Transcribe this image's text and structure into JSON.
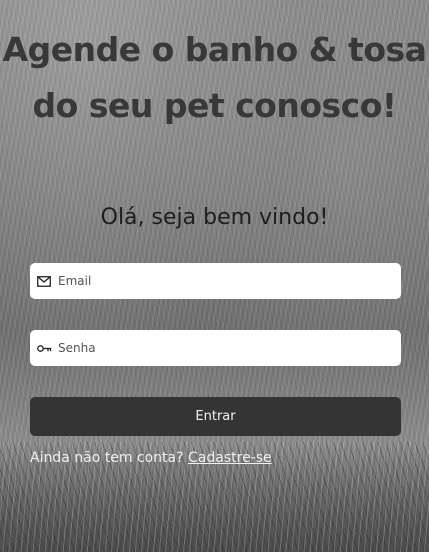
{
  "hero": {
    "title_line1": "Agende o banho & tosa",
    "title_line2": "do seu pet conosco!"
  },
  "login": {
    "welcome": "Olá, seja bem vindo!",
    "email": {
      "placeholder": "Email",
      "value": "",
      "icon": "mail-icon"
    },
    "password": {
      "placeholder": "Senha",
      "value": "",
      "icon": "key-icon"
    },
    "submit_label": "Entrar",
    "signup_prompt": "Ainda não tem conta?",
    "signup_link": "Cadastre-se"
  },
  "colors": {
    "button_bg": "#343434",
    "title_text": "#383838",
    "field_bg": "#ffffff"
  }
}
